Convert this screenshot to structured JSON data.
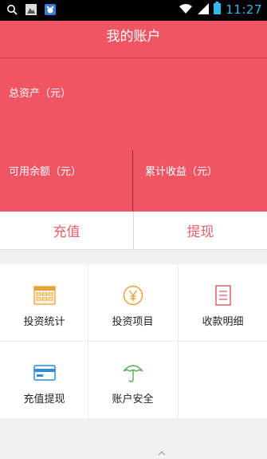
{
  "status_bar": {
    "time": "11:27",
    "left_icons": [
      "search-icon",
      "image-icon",
      "app-icon"
    ],
    "right_icons": [
      "wifi-icon",
      "signal-icon",
      "battery-icon"
    ]
  },
  "header": {
    "title": "我的账户",
    "total_assets_label": "总资产（元）",
    "available_balance_label": "可用余额（元）",
    "cumulative_income_label": "累计收益（元）",
    "bg_color": "#f05563"
  },
  "actions": {
    "recharge": "充值",
    "withdraw": "提现"
  },
  "grid": [
    {
      "label": "投资统计",
      "icon": "statistics-icon"
    },
    {
      "label": "投资项目",
      "icon": "yen-coin-icon"
    },
    {
      "label": "收款明细",
      "icon": "document-icon"
    },
    {
      "label": "充值提现",
      "icon": "card-icon"
    },
    {
      "label": "账户安全",
      "icon": "umbrella-icon"
    }
  ]
}
